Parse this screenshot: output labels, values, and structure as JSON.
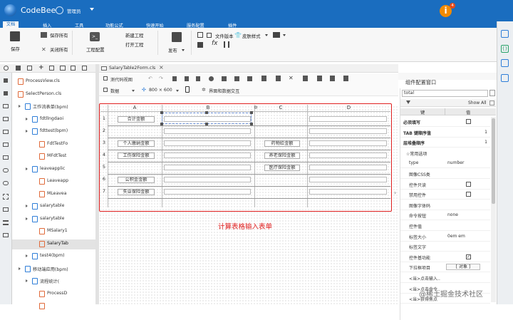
{
  "app": {
    "name": "CodeBee",
    "user": "管理员",
    "notify_count": "4"
  },
  "menu_tabs": [
    {
      "label": "文档"
    },
    {
      "label": "插入"
    },
    {
      "label": "工具"
    },
    {
      "label": "功能公式"
    },
    {
      "label": "快速开始"
    },
    {
      "label": "服务配置"
    },
    {
      "label": "插件"
    }
  ],
  "ribbon": {
    "save": "保存",
    "save_all": "保存所有",
    "close_all": "关闭所有",
    "workspace": "工程配置",
    "new_project": "新建工程",
    "open_project": "打开工程",
    "publish": "发布",
    "file_version": "文件版本",
    "skin": "皮肤样式"
  },
  "tree": {
    "items": [
      {
        "label": "ProcessView.cls",
        "indent": 0
      },
      {
        "label": "SelectPerson.cls",
        "indent": 0
      },
      {
        "label": "工作流表单(bpm)",
        "indent": 1
      },
      {
        "label": "fdtllngdaoi",
        "indent": 2
      },
      {
        "label": "fdttest(bpm)",
        "indent": 2
      },
      {
        "label": "FdtTestFo",
        "indent": 3
      },
      {
        "label": "MFdtTest",
        "indent": 3
      },
      {
        "label": "leaveapplic",
        "indent": 2
      },
      {
        "label": "Leaveapp",
        "indent": 3
      },
      {
        "label": "MLeavea",
        "indent": 3
      },
      {
        "label": "salarytable",
        "indent": 2
      },
      {
        "label": "salarytable",
        "indent": 2
      },
      {
        "label": "MSalary1",
        "indent": 3
      },
      {
        "label": "SalaryTab",
        "indent": 3
      },
      {
        "label": "test4(bpm)",
        "indent": 2
      },
      {
        "label": "移动端应用(bpm)",
        "indent": 1
      },
      {
        "label": "流程统计(",
        "indent": 2
      },
      {
        "label": "ProcessD",
        "indent": 3
      },
      {
        "label": "",
        "indent": 3
      }
    ]
  },
  "editor": {
    "tab_label": "SalaryTable2Form.cls",
    "design_view": "测代码视图",
    "data_label": "数据",
    "size_label": "800 × 600",
    "interact_label": "界面和数据交互",
    "annotation": "计算表格输入表单"
  },
  "grid": {
    "columns": [
      "A",
      "B",
      "C",
      "D"
    ],
    "rows": [
      "1",
      "2",
      "3",
      "4",
      "5",
      "6",
      "7"
    ],
    "cells": [
      {
        "row": 0,
        "col": 0,
        "text": "合计金额"
      },
      {
        "row": 2,
        "col": 0,
        "text": "个人缴纳金额"
      },
      {
        "row": 2,
        "col": 2,
        "text": "药物给金额"
      },
      {
        "row": 3,
        "col": 0,
        "text": "工伤保险金额"
      },
      {
        "row": 3,
        "col": 2,
        "text": "养老保险金额"
      },
      {
        "row": 4,
        "col": 2,
        "text": "医疗保险金额"
      },
      {
        "row": 5,
        "col": 0,
        "text": "公积金金额"
      },
      {
        "row": 6,
        "col": 0,
        "text": "失业保险金额"
      }
    ]
  },
  "props": {
    "title": "组件配置窗口",
    "search_value": "total",
    "show_all": "Show All",
    "col_key": "键",
    "col_val": "值",
    "rows": [
      {
        "k": "必须填写",
        "v": "",
        "kind": "checkbox",
        "bold": true
      },
      {
        "k": "TAB 键顺序值",
        "v": "1",
        "kind": "text",
        "bold": true
      },
      {
        "k": "层堆叠顺序",
        "v": "1",
        "kind": "text",
        "bold": true
      },
      {
        "k": "☆常用选项",
        "v": "",
        "kind": "section",
        "bold": false
      },
      {
        "k": "type",
        "v": "number",
        "kind": "text",
        "bold": false
      },
      {
        "k": "图像CSS类",
        "v": "",
        "kind": "text",
        "bold": false
      },
      {
        "k": "控件只读",
        "v": "",
        "kind": "checkbox",
        "bold": false
      },
      {
        "k": "禁用控件",
        "v": "",
        "kind": "checkbox",
        "bold": false
      },
      {
        "k": "图像字体码",
        "v": "",
        "kind": "text",
        "bold": false
      },
      {
        "k": "命令按钮",
        "v": "none",
        "kind": "text",
        "bold": false
      },
      {
        "k": "控件值",
        "v": "",
        "kind": "text",
        "bold": false
      },
      {
        "k": "标签大小",
        "v": "0em em",
        "kind": "text",
        "bold": false
      },
      {
        "k": "标签文字",
        "v": "",
        "kind": "text",
        "bold": false
      },
      {
        "k": "控件基功能",
        "v": "",
        "kind": "checked",
        "bold": false
      },
      {
        "k": "下拉框项目",
        "v": "[ 对象 ]",
        "kind": "text",
        "bold": false
      },
      {
        "k": "<当>点击输入...",
        "v": "",
        "kind": "text",
        "bold": false
      },
      {
        "k": "<当>点击命令...",
        "v": "",
        "kind": "text",
        "bold": false
      },
      {
        "k": "<当>获得焦点",
        "v": "",
        "kind": "text",
        "bold": false
      }
    ]
  },
  "watermark": "@稀土掘金技术社区",
  "colors": {
    "brand": "#1a6dbf",
    "annotation": "#e02020"
  }
}
